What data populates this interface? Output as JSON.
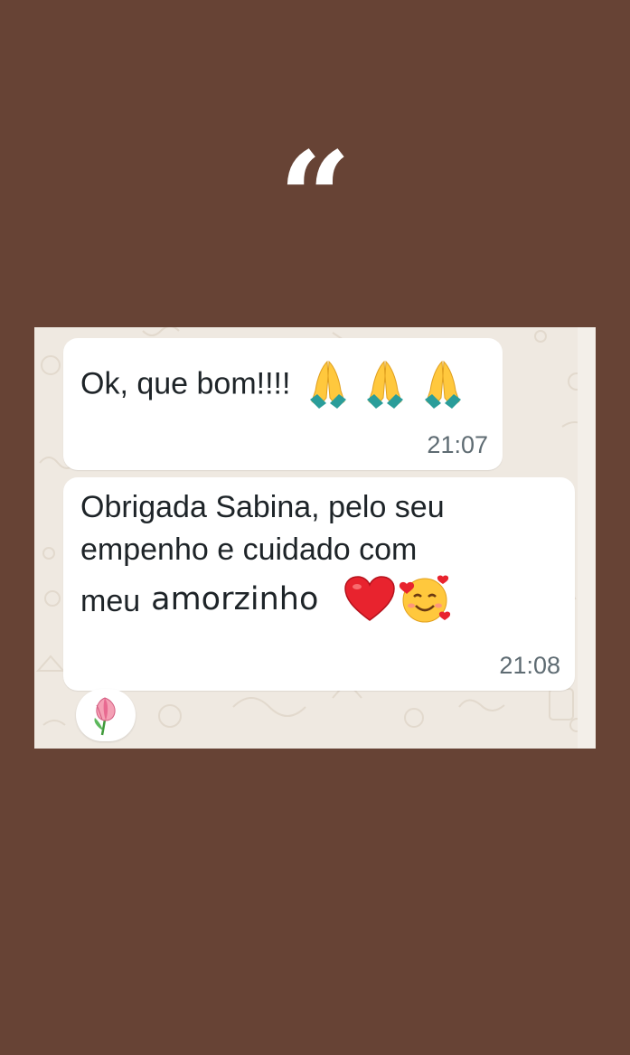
{
  "page": {
    "quote_mark": "“",
    "background_color": "#674335",
    "chat_background_color": "#efe9e1"
  },
  "messages": [
    {
      "text": "Ok, que bom!!!!",
      "emojis": [
        "folded-hands",
        "folded-hands",
        "folded-hands"
      ],
      "time": "21:07"
    },
    {
      "lines": [
        "Obrigada Sabina, pelo seu",
        "empenho e cuidado com",
        "meu"
      ],
      "overlay_word": "amorzinho",
      "emojis": [
        "red-heart",
        "smiling-face-with-hearts"
      ],
      "time": "21:08"
    }
  ],
  "reaction": {
    "emoji": "tulip"
  }
}
